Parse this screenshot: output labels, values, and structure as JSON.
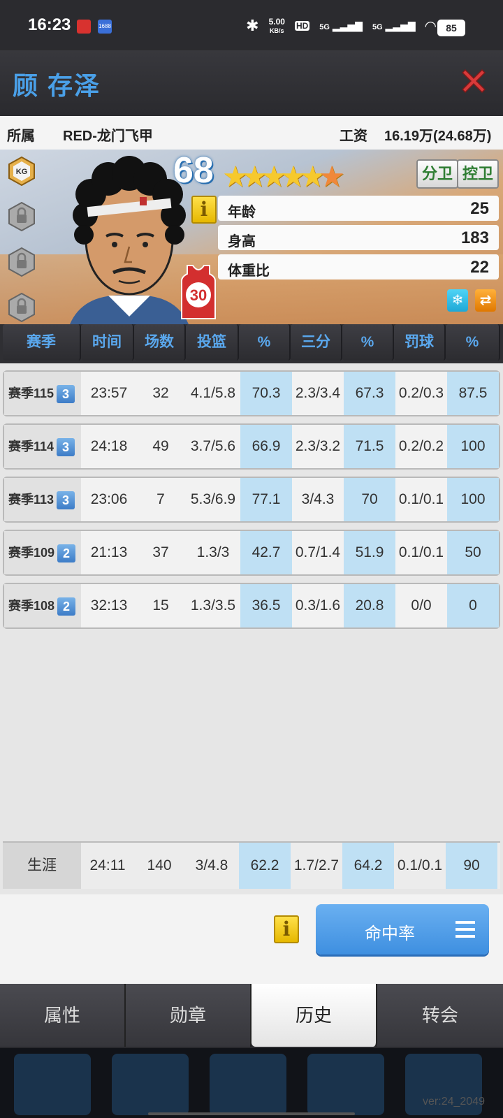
{
  "status_bar": {
    "time": "16:23",
    "net_speed": "5.00",
    "net_unit": "KB/s",
    "battery": "85",
    "signal_1": "5G",
    "signal_2": "5G",
    "hd": "HD"
  },
  "player": {
    "name": "顾 存泽",
    "rating": "68",
    "jersey_number": "30",
    "positions": [
      "分卫",
      "控卫"
    ],
    "stars": 5.5
  },
  "info_bar": {
    "team_label": "所属",
    "team": "RED-龙门飞甲",
    "salary_label": "工资",
    "salary": "16.19万(24.68万)"
  },
  "attributes": [
    {
      "label": "年龄",
      "value": "25"
    },
    {
      "label": "身高",
      "value": "183"
    },
    {
      "label": "体重比",
      "value": "22"
    }
  ],
  "badge_icon": "KG",
  "table": {
    "headers": [
      "赛季",
      "时间",
      "场数",
      "投篮",
      "%",
      "三分",
      "%",
      "罚球",
      "%"
    ],
    "rows": [
      {
        "season": "赛季115",
        "level": "3",
        "time": "23:57",
        "games": "32",
        "fg": "4.1/5.8",
        "fg_pct": "70.3",
        "three": "2.3/3.4",
        "three_pct": "67.3",
        "ft": "0.2/0.3",
        "ft_pct": "87.5"
      },
      {
        "season": "赛季114",
        "level": "3",
        "time": "24:18",
        "games": "49",
        "fg": "3.7/5.6",
        "fg_pct": "66.9",
        "three": "2.3/3.2",
        "three_pct": "71.5",
        "ft": "0.2/0.2",
        "ft_pct": "100"
      },
      {
        "season": "赛季113",
        "level": "3",
        "time": "23:06",
        "games": "7",
        "fg": "5.3/6.9",
        "fg_pct": "77.1",
        "three": "3/4.3",
        "three_pct": "70",
        "ft": "0.1/0.1",
        "ft_pct": "100"
      },
      {
        "season": "赛季109",
        "level": "2",
        "time": "21:13",
        "games": "37",
        "fg": "1.3/3",
        "fg_pct": "42.7",
        "three": "0.7/1.4",
        "three_pct": "51.9",
        "ft": "0.1/0.1",
        "ft_pct": "50"
      },
      {
        "season": "赛季108",
        "level": "2",
        "time": "32:13",
        "games": "15",
        "fg": "1.3/3.5",
        "fg_pct": "36.5",
        "three": "0.3/1.6",
        "three_pct": "20.8",
        "ft": "0/0",
        "ft_pct": "0"
      }
    ],
    "career": {
      "label": "生涯",
      "time": "24:11",
      "games": "140",
      "fg": "3/4.8",
      "fg_pct": "62.2",
      "three": "1.7/2.7",
      "three_pct": "64.2",
      "ft": "0.1/0.1",
      "ft_pct": "90"
    }
  },
  "actions": {
    "primary_label": "命中率",
    "info_icon": "i"
  },
  "tabs": [
    "属性",
    "勋章",
    "历史",
    "转会"
  ],
  "active_tab": "历史",
  "version": "ver:24_2049",
  "colors": {
    "accent_blue": "#4aa0e8",
    "close_red": "#d93a3a",
    "pct_highlight": "#bfe0f4",
    "button_blue": "#3e8fe0"
  }
}
